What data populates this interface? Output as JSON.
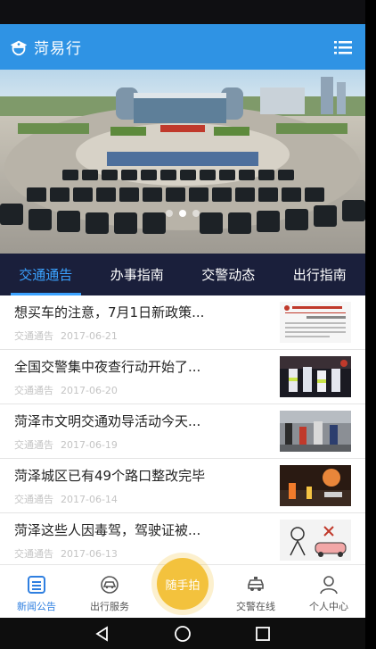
{
  "app": {
    "title": "菏易行"
  },
  "tabs": [
    {
      "label": "交通通告",
      "active": true
    },
    {
      "label": "办事指南",
      "active": false
    },
    {
      "label": "交警动态",
      "active": false
    },
    {
      "label": "出行指南",
      "active": false
    }
  ],
  "banner": {
    "slide_count": 3,
    "active_slide": 2
  },
  "news": [
    {
      "title": "想买车的注意，7月1日新政策...",
      "category": "交通通告",
      "date": "2017-06-21"
    },
    {
      "title": "全国交警集中夜查行动开始了...",
      "category": "交通通告",
      "date": "2017-06-20"
    },
    {
      "title": "菏泽市文明交通劝导活动今天...",
      "category": "交通通告",
      "date": "2017-06-19"
    },
    {
      "title": "菏泽城区已有49个路口整改完毕",
      "category": "交通通告",
      "date": "2017-06-14"
    },
    {
      "title": "菏泽这些人因毒驾，驾驶证被...",
      "category": "交通通告",
      "date": "2017-06-13"
    }
  ],
  "bottom_nav": {
    "items": [
      {
        "label": "新闻公告",
        "icon": "news-icon",
        "active": true
      },
      {
        "label": "出行服务",
        "icon": "travel-service-icon",
        "active": false
      },
      {
        "label": "交警在线",
        "icon": "police-car-icon",
        "active": false
      },
      {
        "label": "个人中心",
        "icon": "person-icon",
        "active": false
      }
    ],
    "fab_label": "随手拍"
  },
  "colors": {
    "app_bar": "#2f93e4",
    "tab_bar": "#1a1f3b",
    "tab_active": "#3ba2ff",
    "fab": "#f3c23d",
    "nav_active": "#2f7fe0"
  }
}
